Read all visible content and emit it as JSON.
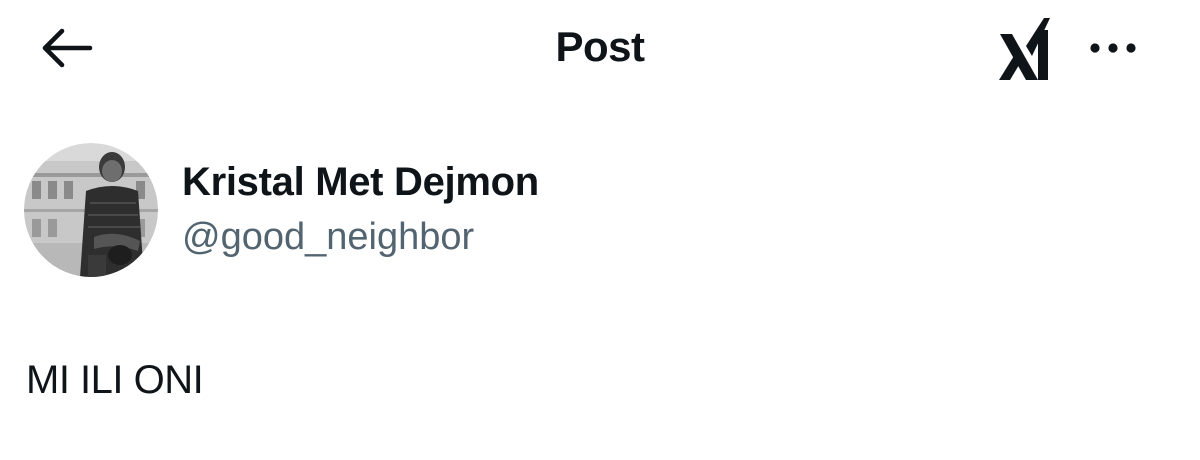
{
  "header": {
    "title": "Post",
    "back_icon": "arrow-left-icon",
    "brand_icon": "xai-logo-icon",
    "more_icon": "more-horizontal-icon"
  },
  "post": {
    "author": {
      "display_name": "Kristal Met Dejmon",
      "handle": "@good_neighbor",
      "avatar": "grayscale-photo-avatar"
    },
    "text": "MI ILI ONI"
  },
  "colors": {
    "text_primary": "#0f1419",
    "text_secondary": "#536471",
    "background": "#ffffff"
  }
}
